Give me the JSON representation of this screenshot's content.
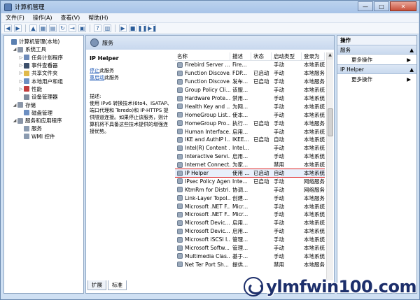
{
  "window": {
    "title": "计算机管理"
  },
  "menu": [
    "文件(F)",
    "操作(A)",
    "查看(V)",
    "帮助(H)"
  ],
  "tree": [
    {
      "label": "计算机管理(本地)",
      "indent": 0,
      "exp": "",
      "color": "#5a7fb0"
    },
    {
      "label": "系统工具",
      "indent": 1,
      "exp": "◢",
      "color": "#8a96a8"
    },
    {
      "label": "任务计划程序",
      "indent": 2,
      "exp": "▷",
      "color": "#6e8bb9"
    },
    {
      "label": "事件查看器",
      "indent": 2,
      "exp": "▷",
      "color": "#3c4f6b"
    },
    {
      "label": "共享文件夹",
      "indent": 2,
      "exp": "▷",
      "color": "#e0b94a"
    },
    {
      "label": "本地用户和组",
      "indent": 2,
      "exp": "▷",
      "color": "#6c8fc2"
    },
    {
      "label": "性能",
      "indent": 2,
      "exp": "▷",
      "color": "#c23d3d"
    },
    {
      "label": "设备管理器",
      "indent": 2,
      "exp": "",
      "color": "#7d8a9c"
    },
    {
      "label": "存储",
      "indent": 1,
      "exp": "◢",
      "color": "#8a96a8"
    },
    {
      "label": "磁盘管理",
      "indent": 2,
      "exp": "",
      "color": "#6c8fc2"
    },
    {
      "label": "服务和应用程序",
      "indent": 1,
      "exp": "◢",
      "color": "#8a96a8"
    },
    {
      "label": "服务",
      "indent": 2,
      "exp": "",
      "color": "#8b9bb0"
    },
    {
      "label": "WMI 控件",
      "indent": 2,
      "exp": "",
      "color": "#8b9bb0"
    }
  ],
  "center": {
    "header": "服务",
    "selected_name": "IP Helper",
    "stop_link": "停止",
    "stop_suffix": "此服务",
    "restart_link": "重启动",
    "restart_suffix": "此服务",
    "desc_label": "描述:",
    "desc_text": "使用 IPv6 转换技术(6to4、ISATAP、端口代理和 Teredo)和 IP-HTTPS 提供隧道连接。如果停止该服务，则计算机将不具备这些技术提供的增强连接优势。"
  },
  "columns": [
    "名称",
    "描述",
    "状态",
    "启动类型",
    "登录为"
  ],
  "rows": [
    [
      "Firebird Server ...",
      "Fire...",
      "",
      "手动",
      "本地系统"
    ],
    [
      "Function Discove...",
      "FDP...",
      "已启动",
      "手动",
      "本地服务"
    ],
    [
      "Function Discove...",
      "发布...",
      "已启动",
      "手动",
      "本地服务"
    ],
    [
      "Group Policy Cli...",
      "该服...",
      "",
      "手动",
      "本地系统"
    ],
    [
      "Hardware Prote...",
      "禁用...",
      "",
      "手动",
      "本地系统"
    ],
    [
      "Health Key and ...",
      "为网...",
      "",
      "手动",
      "本地系统"
    ],
    [
      "HomeGroup List...",
      "使本...",
      "",
      "手动",
      "本地系统"
    ],
    [
      "HomeGroup Pro...",
      "执行...",
      "已启动",
      "手动",
      "本地服务"
    ],
    [
      "Human Interface...",
      "启用...",
      "",
      "手动",
      "本地系统"
    ],
    [
      "IKE and AuthIP I...",
      "IKEE...",
      "已启动",
      "自动",
      "本地系统"
    ],
    [
      "Intel(R) Content ...",
      "Intel...",
      "",
      "手动",
      "本地系统"
    ],
    [
      "Interactive Servi...",
      "启用...",
      "",
      "手动",
      "本地系统"
    ],
    [
      "Internet Connect...",
      "为家...",
      "",
      "禁用",
      "本地系统"
    ],
    [
      "IP Helper",
      "使用 ...",
      "已启动",
      "自动",
      "本地系统"
    ],
    [
      "IPsec Policy Agent",
      "Inte...",
      "已启动",
      "手动",
      "网络服务"
    ],
    [
      "KtmRm for Distri...",
      "协调...",
      "",
      "手动",
      "网络服务"
    ],
    [
      "Link-Layer Topol...",
      "创建...",
      "",
      "手动",
      "本地服务"
    ],
    [
      "Microsoft .NET F...",
      "Micr...",
      "",
      "手动",
      "本地系统"
    ],
    [
      "Microsoft .NET F...",
      "Micr...",
      "",
      "手动",
      "本地系统"
    ],
    [
      "Microsoft Devic...",
      "启用...",
      "",
      "手动",
      "本地系统"
    ],
    [
      "Microsoft Devic...",
      "启用...",
      "",
      "手动",
      "本地系统"
    ],
    [
      "Microsoft iSCSI I...",
      "管理...",
      "",
      "手动",
      "本地系统"
    ],
    [
      "Microsoft Softw...",
      "管理...",
      "",
      "手动",
      "本地系统"
    ],
    [
      "Multimedia Clas...",
      "基于...",
      "",
      "手动",
      "本地系统"
    ],
    [
      "Net Ter Port Sh...",
      "提供...",
      "",
      "禁用",
      "本地服务"
    ]
  ],
  "selected_index": 13,
  "tabs": [
    "扩展",
    "标准"
  ],
  "actions": {
    "header": "操作",
    "sections": [
      {
        "title": "服务",
        "item": "更多操作"
      },
      {
        "title": "IP Helper",
        "item": "更多操作"
      }
    ]
  },
  "watermark": "ylmfwin100.com"
}
